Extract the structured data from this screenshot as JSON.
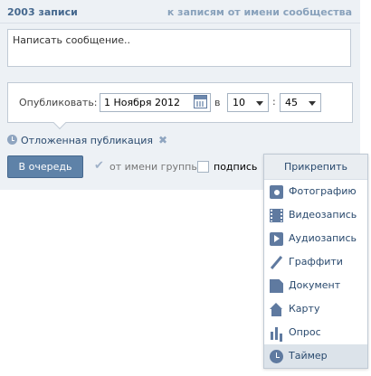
{
  "header": {
    "count": "2003 записи",
    "community_link": "к записям от имени сообщества"
  },
  "composer": {
    "placeholder": "Написать сообщение.."
  },
  "publish": {
    "label": "Опубликовать:",
    "date": "1 Ноября 2012",
    "in_word": "в",
    "hour": "10",
    "colon": ":",
    "minute": "45"
  },
  "delayed": {
    "label": "Отложенная публикация"
  },
  "actions": {
    "queue_button": "В очередь",
    "as_group_label": "от имени группы",
    "as_group_checked": true,
    "signature_label": "подпись",
    "signature_checked": false
  },
  "attach_menu": {
    "title": "Прикрепить",
    "items": [
      {
        "label": "Фотографию",
        "icon": "photo-icon"
      },
      {
        "label": "Видеозапись",
        "icon": "video-icon"
      },
      {
        "label": "Аудиозапись",
        "icon": "audio-icon"
      },
      {
        "label": "Граффити",
        "icon": "graffiti-icon"
      },
      {
        "label": "Документ",
        "icon": "document-icon"
      },
      {
        "label": "Карту",
        "icon": "map-icon"
      },
      {
        "label": "Опрос",
        "icon": "poll-icon"
      },
      {
        "label": "Таймер",
        "icon": "timer-icon",
        "active": true
      }
    ]
  },
  "colors": {
    "accent": "#45688e",
    "button": "#5e82a8",
    "panel_bg": "#edf1f5"
  }
}
